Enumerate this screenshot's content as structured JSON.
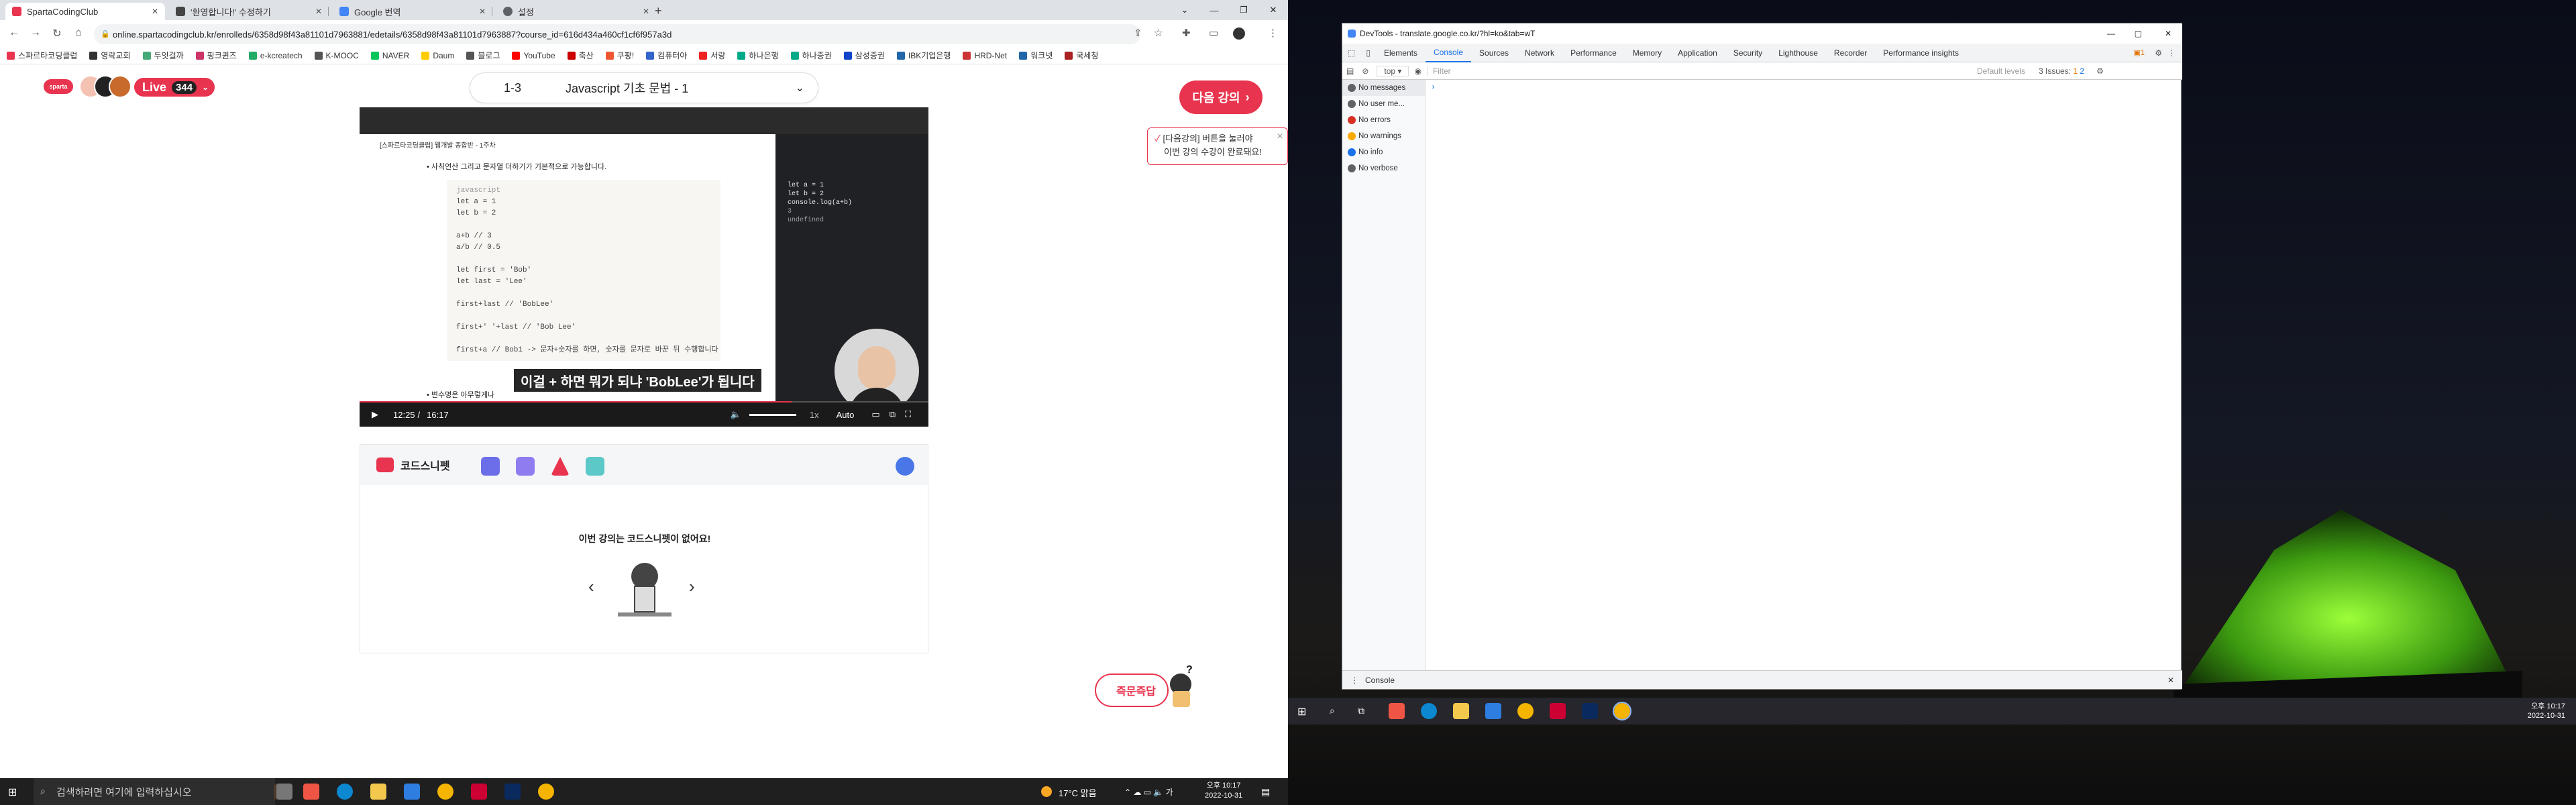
{
  "browser_left": {
    "tabs": [
      {
        "title": "SpartaCodingClub",
        "color": "#e8344e"
      },
      {
        "title": "'환영합니다!' 수정하기",
        "color": "#444"
      },
      {
        "title": "Google 번역",
        "color": "#4285f4"
      },
      {
        "title": "설정",
        "color": "#5f6368"
      }
    ],
    "url": "online.spartacodingclub.kr/enrolleds/6358d98f43a81101d7963881/edetails/6358d98f43a81101d7963887?course_id=616d434a460cf1cf6f957a3d",
    "bookmarks": [
      "스파르타코딩클럽",
      "영락교회",
      "두잇걸까",
      "핑크퀸즈",
      "e-kcreatech",
      "K-MOOC",
      "NAVER",
      "Daum",
      "블로그",
      "YouTube",
      "축산",
      "쿠팡!",
      "컴퓨터아",
      "서랑",
      "하나은행",
      "하나증권",
      "삼성증권",
      "IBK기업은행",
      "HRD-Net",
      "워크넷",
      "국세청"
    ]
  },
  "page": {
    "live_label": "Live",
    "live_count": "344",
    "lesson_num": "1-3",
    "lesson_title": "Javascript 기초 문법 - 1",
    "next_button": "다음 강의",
    "tip_line1": "[다음강의] 버튼을 눌러야",
    "tip_line2": "이번 강의 수강이 완료돼요!",
    "video": {
      "notion_title": "[스파르타코딩클럽] 웹개발 종합반 - 1주차",
      "bullet_top": "사칙연산 그리고 문자열 더하기가 기본적으로 가능합니다.",
      "code_lines": [
        "javascript",
        "let a = 1",
        "let b = 2",
        "",
        "a+b // 3",
        "a/b // 0.5",
        "",
        "let first = 'Bob'",
        "let last = 'Lee'",
        "",
        "first+last // 'BobLee'",
        "",
        "first+' '+last // 'Bob Lee'",
        "",
        "first+a // Bob1 -> 문자+숫자를 하면, 숫자를 문자로 바꾼 뒤 수행합니다"
      ],
      "bullet_bottom": "변수명은 아무렇게나",
      "devtools_lines": [
        "let a = 1",
        "let b = 2",
        "console.log(a+b)",
        "3",
        "undefined"
      ],
      "subtitle": "이걸 + 하면 뭐가 되냐 'BobLee'가 됩니다",
      "time_current": "12:25",
      "time_total": "16:17",
      "speed": "1x",
      "quality": "Auto",
      "progress": 0.76
    },
    "snippet_title": "코드스니펫",
    "snippet_empty": "이번 강의는 코드스니펫이 없어요!",
    "help_button": "즉문즉답"
  },
  "taskbar_left": {
    "search_placeholder": "검색하려면 여기에 입력하십시오",
    "weather": "17°C 맑음",
    "time": "오후 10:17",
    "date": "2022-10-31"
  },
  "devtools": {
    "window_title": "DevTools - translate.google.co.kr/?hl=ko&tab=wT",
    "tabs": [
      "Elements",
      "Console",
      "Sources",
      "Network",
      "Performance",
      "Memory",
      "Application",
      "Security",
      "Lighthouse",
      "Recorder",
      "Performance insights"
    ],
    "active_tab": "Console",
    "context": "top",
    "filter_placeholder": "Filter",
    "levels": "Default levels",
    "issues": "3 Issues:",
    "issues_warn": "1",
    "issues_info": "2",
    "sidebar": [
      {
        "label": "No messages",
        "color": "#5f6368"
      },
      {
        "label": "No user me...",
        "color": "#5f6368"
      },
      {
        "label": "No errors",
        "color": "#d93025"
      },
      {
        "label": "No warnings",
        "color": "#f9ab00"
      },
      {
        "label": "No info",
        "color": "#1a73e8"
      },
      {
        "label": "No verbose",
        "color": "#5f6368"
      }
    ],
    "drawer_label": "Console"
  },
  "taskbar_right": {
    "time": "오후 10:17",
    "date": "2022-10-31"
  }
}
